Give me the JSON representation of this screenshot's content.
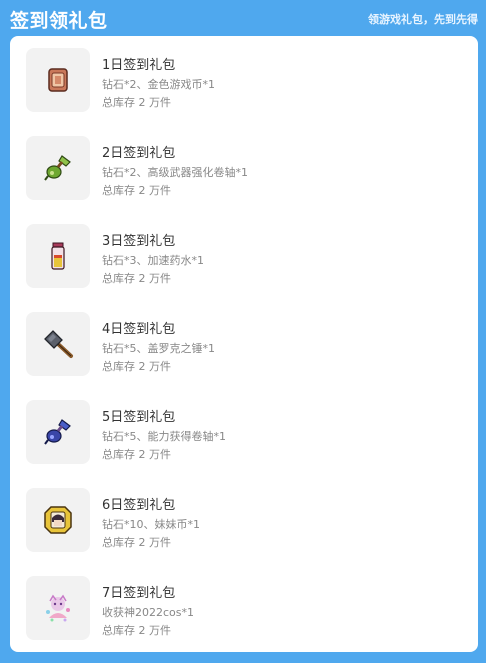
{
  "header": {
    "title": "签到领礼包",
    "subtitle": "领游戏礼包，先到先得"
  },
  "gifts": [
    {
      "name": "1日签到礼包",
      "desc": "钻石*2、金色游戏币*1",
      "stock": "总库存 2 万件",
      "icon": "copper-token-icon"
    },
    {
      "name": "2日签到礼包",
      "desc": "钻石*2、高级武器强化卷轴*1",
      "stock": "总库存 2 万件",
      "icon": "green-scroll-icon"
    },
    {
      "name": "3日签到礼包",
      "desc": "钻石*3、加速药水*1",
      "stock": "总库存 2 万件",
      "icon": "potion-vial-icon"
    },
    {
      "name": "4日签到礼包",
      "desc": "钻石*5、盖罗克之锤*1",
      "stock": "总库存 2 万件",
      "icon": "hammer-icon"
    },
    {
      "name": "5日签到礼包",
      "desc": "钻石*5、能力获得卷轴*1",
      "stock": "总库存 2 万件",
      "icon": "blue-scroll-icon"
    },
    {
      "name": "6日签到礼包",
      "desc": "钻石*10、妹妹币*1",
      "stock": "总库存 2 万件",
      "icon": "sister-coin-icon"
    },
    {
      "name": "7日签到礼包",
      "desc": "收获神2022cos*1",
      "stock": "总库存 2 万件",
      "icon": "anime-costume-icon"
    }
  ]
}
